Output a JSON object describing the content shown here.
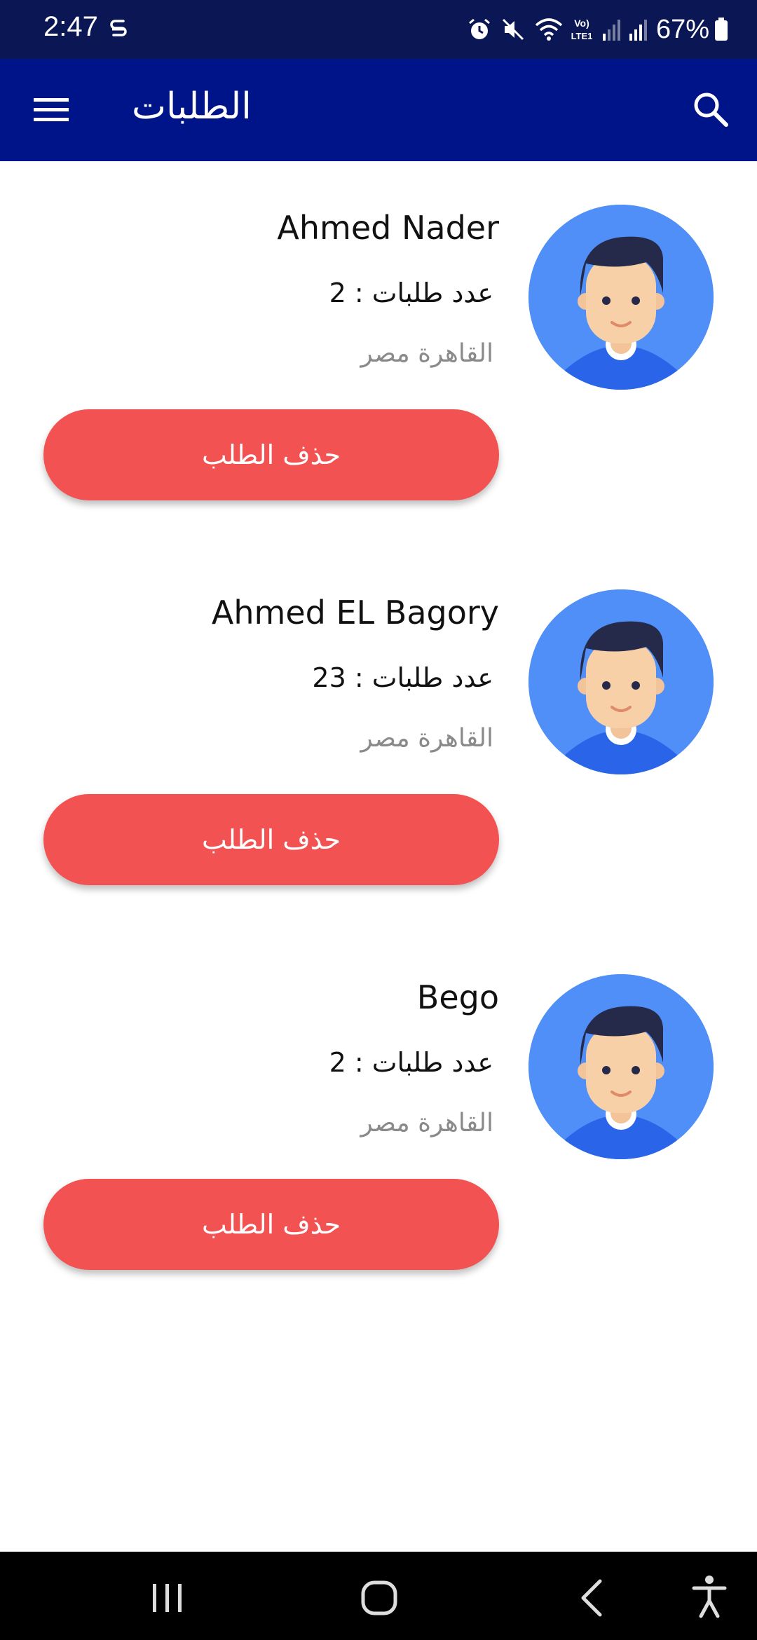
{
  "status_bar": {
    "time": "2:47",
    "battery_percent": "67%",
    "icons": [
      "s-icon",
      "alarm-icon",
      "mute-icon",
      "wifi-icon",
      "volte-icon",
      "signal-icon",
      "signal-icon",
      "battery-icon"
    ]
  },
  "app_bar": {
    "title": "الطلبات",
    "left_icon": "menu-icon",
    "right_icon": "search-icon",
    "color": "#001489"
  },
  "requests": [
    {
      "name": "Ahmed Nader",
      "count_label": "عدد طلبات :",
      "count": "2",
      "city": "القاهرة مصر",
      "delete_label": "حذف الطلب"
    },
    {
      "name": "Ahmed EL Bagory",
      "count_label": "عدد طلبات :",
      "count": "23",
      "city": "القاهرة مصر",
      "delete_label": "حذف الطلب"
    },
    {
      "name": "Bego",
      "count_label": "عدد طلبات :",
      "count": "2",
      "city": "القاهرة مصر",
      "delete_label": "حذف الطلب"
    }
  ],
  "colors": {
    "status_bar": "#0b1654",
    "delete_button": "#f25252",
    "avatar_bg": "#4f8ff7"
  },
  "nav_bar": {
    "icons": [
      "recents-icon",
      "home-icon",
      "back-icon",
      "accessibility-icon"
    ]
  }
}
